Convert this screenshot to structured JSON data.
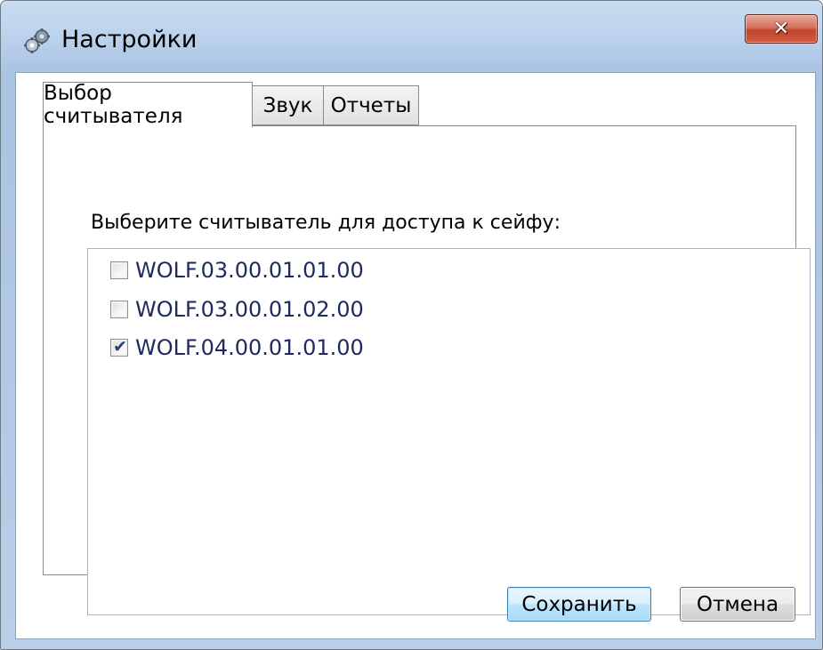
{
  "window": {
    "title": "Настройки",
    "icon": "settings-gears-icon",
    "close_glyph": "✕"
  },
  "tabs": [
    {
      "label": "Выбор считывателя",
      "active": true
    },
    {
      "label": "Звук",
      "active": false
    },
    {
      "label": "Отчеты",
      "active": false
    }
  ],
  "reader_tab": {
    "prompt": "Выберите считыватель для доступа к сейфу:",
    "readers": [
      {
        "label": "WOLF.03.00.01.01.00",
        "checked": false
      },
      {
        "label": "WOLF.03.00.01.02.00",
        "checked": false
      },
      {
        "label": "WOLF.04.00.01.01.00",
        "checked": true
      }
    ],
    "check_glyph": "✔"
  },
  "buttons": {
    "save_label": "Сохранить",
    "cancel_label": "Отмена"
  },
  "colors": {
    "item_text": "#1c2a5e",
    "check_mark": "#2a3f7e",
    "default_button_border": "#3c7fb1",
    "close_button": "#c2442d"
  }
}
